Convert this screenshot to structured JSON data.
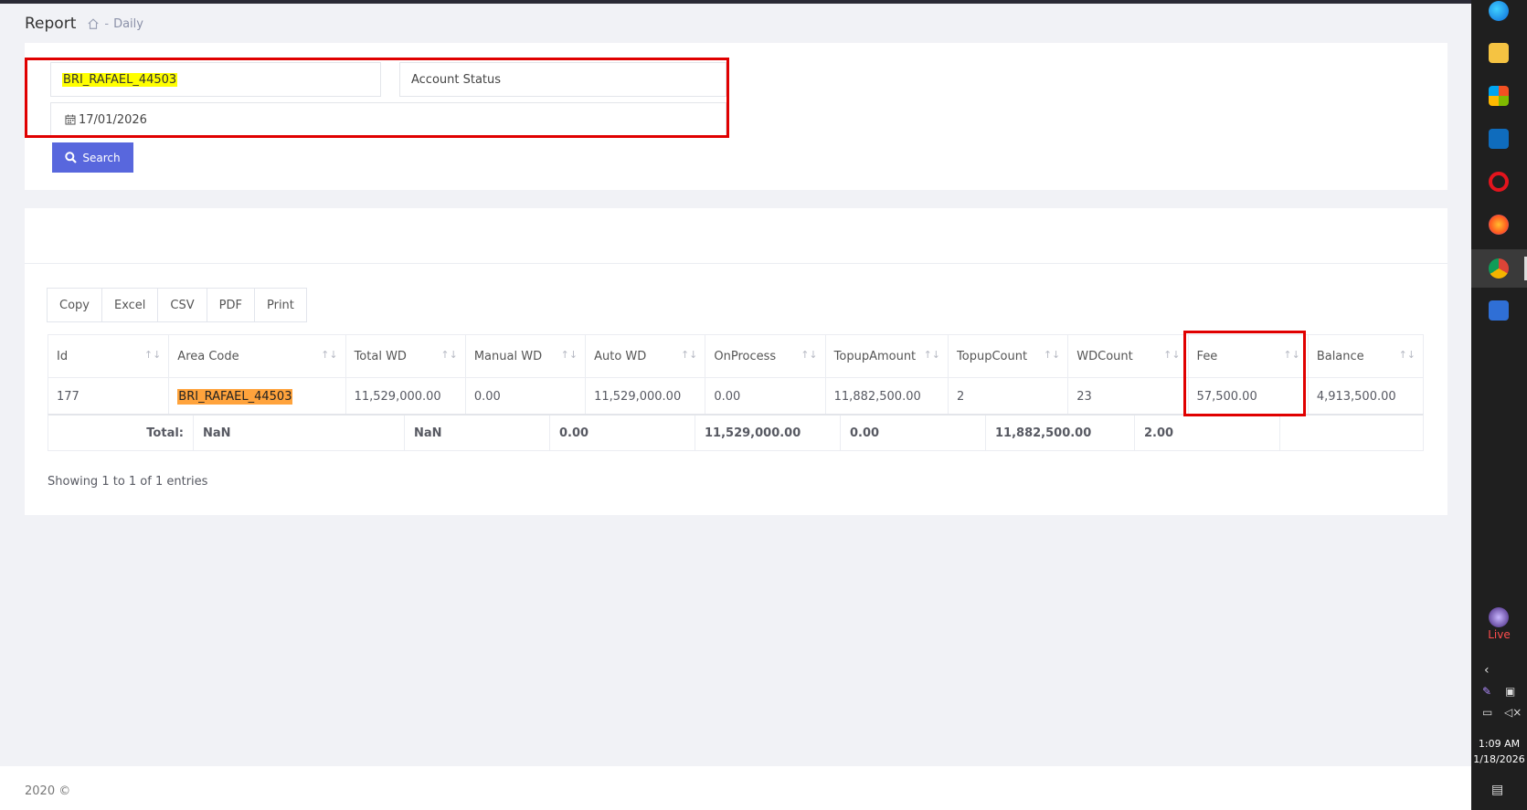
{
  "header": {
    "title": "Report",
    "breadcrumb_sep": "-",
    "breadcrumb_current": "Daily"
  },
  "filters": {
    "area_code_value": "BRI_RAFAEL_44503",
    "status_placeholder": "Account Status",
    "date_value": "17/01/2026",
    "search_label": "Search"
  },
  "export_buttons": [
    "Copy",
    "Excel",
    "CSV",
    "PDF",
    "Print"
  ],
  "table": {
    "columns": [
      "Id",
      "Area Code",
      "Total WD",
      "Manual WD",
      "Auto WD",
      "OnProcess",
      "TopupAmount",
      "TopupCount",
      "WDCount",
      "Fee",
      "Balance"
    ],
    "rows": [
      [
        "177",
        "BRI_RAFAEL_44503",
        "11,529,000.00",
        "0.00",
        "11,529,000.00",
        "0.00",
        "11,882,500.00",
        "2",
        "23",
        "57,500.00",
        "4,913,500.00"
      ]
    ],
    "totals": {
      "label": "Total:",
      "values": [
        "NaN",
        "NaN",
        "0.00",
        "11,529,000.00",
        "0.00",
        "11,882,500.00",
        "2.00",
        ""
      ]
    }
  },
  "info_text": "Showing 1 to 1 of 1 entries",
  "footer": {
    "copyright": "2020 ©"
  },
  "taskbar": {
    "apps": [
      "edge-icon",
      "file-explorer-icon",
      "store-icon",
      "outlook-icon",
      "opera-icon",
      "firefox-icon",
      "chrome-icon",
      "calculator-icon"
    ],
    "live_label": "Live",
    "time": "1:09 AM",
    "date": "1/18/2026"
  }
}
